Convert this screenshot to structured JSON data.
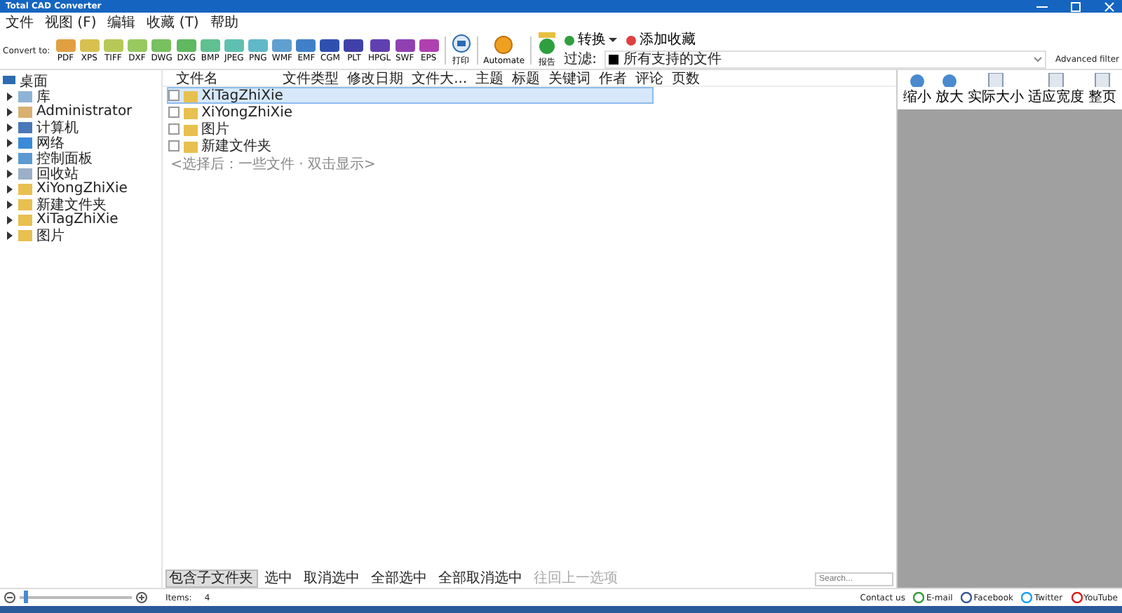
{
  "window": {
    "title": "Total CAD Converter"
  },
  "menu": [
    "文件",
    "视图 (F)",
    "编辑",
    "收藏 (T)",
    "帮助"
  ],
  "toolbar": {
    "convert_label": "Convert to:",
    "formats": [
      {
        "label": "PDF",
        "color": "#e0a040"
      },
      {
        "label": "XPS",
        "color": "#d8c050"
      },
      {
        "label": "TIFF",
        "color": "#b8c858"
      },
      {
        "label": "DXF",
        "color": "#98c860"
      },
      {
        "label": "DWG",
        "color": "#78c060"
      },
      {
        "label": "DXG",
        "color": "#60b860"
      },
      {
        "label": "BMP",
        "color": "#60c090"
      },
      {
        "label": "JPEG",
        "color": "#60c0b0"
      },
      {
        "label": "PNG",
        "color": "#60b8c8"
      },
      {
        "label": "WMF",
        "color": "#60a0d0"
      },
      {
        "label": "EMF",
        "color": "#4080c8"
      },
      {
        "label": "CGM",
        "color": "#3050b0"
      },
      {
        "label": "PLT",
        "color": "#4040a8"
      },
      {
        "label": "HPGL",
        "color": "#6040b0"
      },
      {
        "label": "SWF",
        "color": "#9040b0"
      },
      {
        "label": "EPS",
        "color": "#b040b0"
      }
    ],
    "print": "打印",
    "automate": "Automate",
    "report": "报告",
    "convert": "转换",
    "favorite": "添加收藏",
    "filter_label": "过滤:",
    "filter_value": "所有支持的文件",
    "advanced": "Advanced filter"
  },
  "tree": {
    "label": "桌面",
    "expanded": true,
    "children": [
      {
        "label": "库",
        "kind": "library"
      },
      {
        "label": "Administrator",
        "kind": "user"
      },
      {
        "label": "计算机",
        "kind": "computer"
      },
      {
        "label": "网络",
        "kind": "network"
      },
      {
        "label": "控制面板",
        "kind": "panel"
      },
      {
        "label": "回收站",
        "kind": "bin"
      },
      {
        "label": "XiYongZhiXie",
        "kind": "folder"
      },
      {
        "label": "新建文件夹",
        "kind": "folder"
      },
      {
        "label": "XiTagZhiXie",
        "kind": "folder"
      },
      {
        "label": "图片",
        "kind": "folder"
      }
    ]
  },
  "table": {
    "columns": [
      "文件名",
      "文件类型",
      "修改日期",
      "文件大...",
      "主题",
      "标题",
      "关键词",
      "作者",
      "评论",
      "页数"
    ],
    "rows": [
      {
        "name": "XiTagZhiXie",
        "selected": true,
        "checked": false
      },
      {
        "name": "XiYongZhiXie",
        "selected": false,
        "checked": false
      },
      {
        "name": "图片",
        "selected": false,
        "checked": false
      },
      {
        "name": "新建文件夹",
        "selected": false,
        "checked": false
      }
    ],
    "hint": "<选择后：一些文件 · 双击显示>"
  },
  "preview_tools": [
    "缩小",
    "放大",
    "实际大小",
    "适应宽度",
    "整页"
  ],
  "bottom_buttons": [
    {
      "label": "包含子文件夹",
      "selected": true,
      "disabled": false
    },
    {
      "label": "选中",
      "selected": false,
      "disabled": false
    },
    {
      "label": "取消选中",
      "selected": false,
      "disabled": false
    },
    {
      "label": "全部选中",
      "selected": false,
      "disabled": false
    },
    {
      "label": "全部取消选中",
      "selected": false,
      "disabled": false
    },
    {
      "label": "往回上一选项",
      "selected": false,
      "disabled": true
    }
  ],
  "search": {
    "placeholder": "Search..."
  },
  "status_bar": {
    "zoom": {
      "level": 0.05
    },
    "items_label": "Items:",
    "items_count": "4",
    "contact": "Contact us",
    "links": [
      "E-mail",
      "Facebook",
      "Twitter",
      "YouTube"
    ]
  }
}
